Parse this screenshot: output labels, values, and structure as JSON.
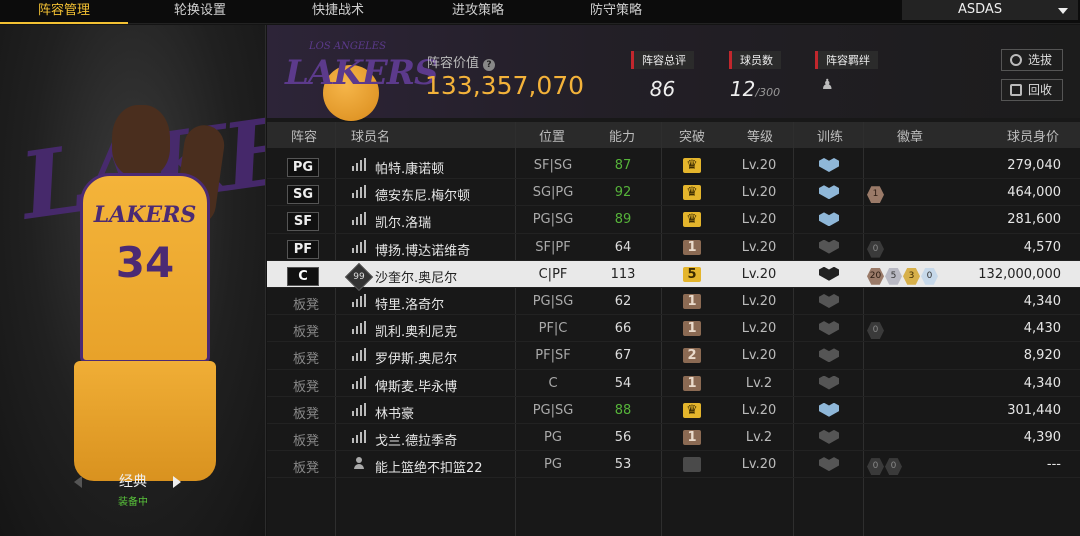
{
  "tabs": [
    {
      "label": "阵容管理",
      "active": true
    },
    {
      "label": "轮换设置",
      "active": false
    },
    {
      "label": "快捷战术",
      "active": false
    },
    {
      "label": "进攻策略",
      "active": false
    },
    {
      "label": "防守策略",
      "active": false
    }
  ],
  "team_select": {
    "value": "ASDAS"
  },
  "player_card": {
    "jersey_word": "LAKERS",
    "jersey_number": "34",
    "style_name": "经典",
    "equipped": "装备中"
  },
  "header": {
    "logo_text": "LAKERS",
    "logo_small": "LOS ANGELES",
    "value_label": "阵容价值",
    "value": "133,357,070",
    "overall_label": "阵容总评",
    "overall": "86",
    "player_count_label": "球员数",
    "player_count": "12",
    "player_count_max": "/300",
    "chem_label": "阵容羁绊",
    "btn_select": "选拔",
    "btn_recycle": "回收"
  },
  "columns": [
    "阵容",
    "球员名",
    "位置",
    "能力",
    "突破",
    "等级",
    "训练",
    "徽章",
    "球员身价"
  ],
  "rows": [
    {
      "slot": "PG",
      "bench": false,
      "icon": "signal",
      "name": "帕特.康诺顿",
      "pos": "SF|SG",
      "ovr": "87",
      "ovr_green": true,
      "brk": "gold",
      "brk_num": "",
      "lvl": "Lv.20",
      "train": "blue",
      "badges": [],
      "value": "279,040",
      "selected": false
    },
    {
      "slot": "SG",
      "bench": false,
      "icon": "signal",
      "name": "德安东尼.梅尔顿",
      "pos": "SG|PG",
      "ovr": "92",
      "ovr_green": true,
      "brk": "gold",
      "brk_num": "",
      "lvl": "Lv.20",
      "train": "blue",
      "badges": [
        {
          "c": "bronze",
          "t": "1"
        }
      ],
      "value": "464,000",
      "selected": false
    },
    {
      "slot": "SF",
      "bench": false,
      "icon": "signal",
      "name": "凯尔.洛瑞",
      "pos": "PG|SG",
      "ovr": "89",
      "ovr_green": true,
      "brk": "gold",
      "brk_num": "",
      "lvl": "Lv.20",
      "train": "blue",
      "badges": [],
      "value": "281,600",
      "selected": false
    },
    {
      "slot": "PF",
      "bench": false,
      "icon": "signal",
      "name": "博扬.博达诺维奇",
      "pos": "SF|PF",
      "ovr": "64",
      "ovr_green": false,
      "brk": "bronze",
      "brk_num": "1",
      "lvl": "Lv.20",
      "train": "dark",
      "badges": [
        {
          "c": "empty",
          "t": "0"
        }
      ],
      "value": "4,570",
      "selected": false
    },
    {
      "slot": "C",
      "bench": false,
      "icon": "ovr99",
      "ovr_icon": "99",
      "name": "沙奎尔.奥尼尔",
      "pos": "C|PF",
      "ovr": "113",
      "ovr_green": false,
      "brk": "gold",
      "brk_num": "5",
      "lvl": "Lv.20",
      "train": "black",
      "badges": [
        {
          "c": "bronze",
          "t": "20"
        },
        {
          "c": "silver",
          "t": "5"
        },
        {
          "c": "gold",
          "t": "3"
        },
        {
          "c": "plat",
          "t": "0"
        }
      ],
      "value": "132,000,000",
      "selected": true
    },
    {
      "slot": "板凳",
      "bench": true,
      "icon": "signal",
      "name": "特里.洛奇尔",
      "pos": "PG|SG",
      "ovr": "62",
      "ovr_green": false,
      "brk": "bronze",
      "brk_num": "1",
      "lvl": "Lv.20",
      "train": "dark",
      "badges": [],
      "value": "4,340",
      "selected": false
    },
    {
      "slot": "板凳",
      "bench": true,
      "icon": "signal",
      "name": "凯利.奥利尼克",
      "pos": "PF|C",
      "ovr": "66",
      "ovr_green": false,
      "brk": "bronze",
      "brk_num": "1",
      "lvl": "Lv.20",
      "train": "dark",
      "badges": [
        {
          "c": "empty",
          "t": "0"
        }
      ],
      "value": "4,430",
      "selected": false
    },
    {
      "slot": "板凳",
      "bench": true,
      "icon": "signal",
      "name": "罗伊斯.奥尼尔",
      "pos": "PF|SF",
      "ovr": "67",
      "ovr_green": false,
      "brk": "bronze",
      "brk_num": "2",
      "lvl": "Lv.20",
      "train": "dark",
      "badges": [],
      "value": "8,920",
      "selected": false
    },
    {
      "slot": "板凳",
      "bench": true,
      "icon": "signal",
      "name": "俾斯麦.毕永博",
      "pos": "C",
      "ovr": "54",
      "ovr_green": false,
      "brk": "bronze",
      "brk_num": "1",
      "lvl": "Lv.2",
      "train": "dark",
      "badges": [],
      "value": "4,340",
      "selected": false
    },
    {
      "slot": "板凳",
      "bench": true,
      "icon": "signal",
      "name": "林书豪",
      "pos": "PG|SG",
      "ovr": "88",
      "ovr_green": true,
      "brk": "gold",
      "brk_num": "",
      "lvl": "Lv.20",
      "train": "blue",
      "badges": [],
      "value": "301,440",
      "selected": false
    },
    {
      "slot": "板凳",
      "bench": true,
      "icon": "signal",
      "name": "戈兰.德拉季奇",
      "pos": "PG",
      "ovr": "56",
      "ovr_green": false,
      "brk": "bronze",
      "brk_num": "1",
      "lvl": "Lv.2",
      "train": "dark",
      "badges": [],
      "value": "4,390",
      "selected": false
    },
    {
      "slot": "板凳",
      "bench": true,
      "icon": "person",
      "name": "能上篮绝不扣篮22",
      "pos": "PG",
      "ovr": "53",
      "ovr_green": false,
      "brk": "grey",
      "brk_num": "",
      "lvl": "Lv.20",
      "train": "dark",
      "badges": [
        {
          "c": "empty",
          "t": "0"
        },
        {
          "c": "empty",
          "t": "0"
        }
      ],
      "value": "---",
      "selected": false
    }
  ]
}
